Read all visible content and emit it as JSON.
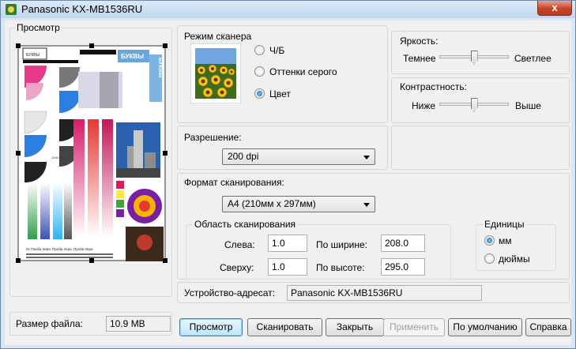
{
  "window": {
    "title": "Panasonic KX-MB1536RU",
    "close_glyph": "x"
  },
  "preview": {
    "group_label": "Просмотр",
    "doc_texts": {
      "corner_box": "БУКВЫ",
      "vertical_word": "БУКВЫ",
      "gray_label": "1250 M",
      "circle_label": "1250 M",
      "blue_word": "БУКВЫ",
      "footer_line": "01 Проба пера. Проба пера. Проба пера"
    }
  },
  "scanner_mode": {
    "group_label": "Режим сканера",
    "options": [
      {
        "label": "Ч/Б",
        "checked": false
      },
      {
        "label": "Оттенки серого",
        "checked": false
      },
      {
        "label": "Цвет",
        "checked": true
      }
    ]
  },
  "brightness": {
    "label": "Яркость:",
    "min_label": "Темнее",
    "max_label": "Светлее",
    "value": 0.5
  },
  "contrast": {
    "label": "Контрастность:",
    "min_label": "Ниже",
    "max_label": "Выше",
    "value": 0.5
  },
  "resolution": {
    "label": "Разрешение:",
    "value": "200 dpi"
  },
  "format": {
    "label": "Формат сканирования:",
    "value": "A4 (210мм x 297мм)"
  },
  "area": {
    "group_label": "Область сканирования",
    "left_label": "Слева:",
    "left_value": "1.0",
    "top_label": "Сверху:",
    "top_value": "1.0",
    "width_label": "По ширине:",
    "width_value": "208.0",
    "height_label": "По высоте:",
    "height_value": "295.0"
  },
  "units": {
    "group_label": "Единицы",
    "options": [
      {
        "label": "мм",
        "checked": true
      },
      {
        "label": "дюймы",
        "checked": false
      }
    ]
  },
  "destination": {
    "label": "Устройство-адресат:",
    "value": "Panasonic KX-MB1536RU"
  },
  "file_size": {
    "label": "Размер файла:",
    "value": "10.9 MB"
  },
  "buttons": {
    "preview": "Просмотр",
    "scan": "Сканировать",
    "close": "Закрыть",
    "apply": "Применить",
    "defaults": "По умолчанию",
    "help": "Справка"
  },
  "colors": {
    "accent": "#1b5fa5",
    "titlebar": "#c2d6ee",
    "close": "#c5442a"
  }
}
